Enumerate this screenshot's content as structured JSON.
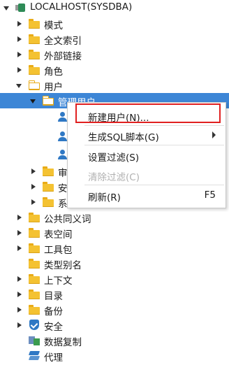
{
  "tree": {
    "root": {
      "label": "LOCALHOST(SYSDBA)"
    },
    "items": [
      {
        "label": "模式"
      },
      {
        "label": "全文索引"
      },
      {
        "label": "外部链接"
      },
      {
        "label": "角色"
      },
      {
        "label": "用户"
      },
      {
        "label": "管理用户"
      },
      {
        "label": "审"
      },
      {
        "label": "安"
      },
      {
        "label": "系"
      },
      {
        "label": "公共同义词"
      },
      {
        "label": "表空间"
      },
      {
        "label": "工具包"
      },
      {
        "label": "类型别名"
      },
      {
        "label": "上下文"
      },
      {
        "label": "目录"
      },
      {
        "label": "备份"
      },
      {
        "label": "安全"
      },
      {
        "label": "数据复制"
      },
      {
        "label": "代理"
      }
    ]
  },
  "context_menu": {
    "new_user": "新建用户(N)...",
    "generate_sql": "生成SQL脚本(G)",
    "set_filter": "设置过滤(S)",
    "clear_filter": "清除过滤(C)",
    "refresh": "刷新(R)",
    "refresh_shortcut": "F5"
  },
  "colors": {
    "selection": "#3d86d6",
    "highlight_border": "#e02020",
    "folder": "#f4c232",
    "user_icon": "#2f78c4"
  }
}
